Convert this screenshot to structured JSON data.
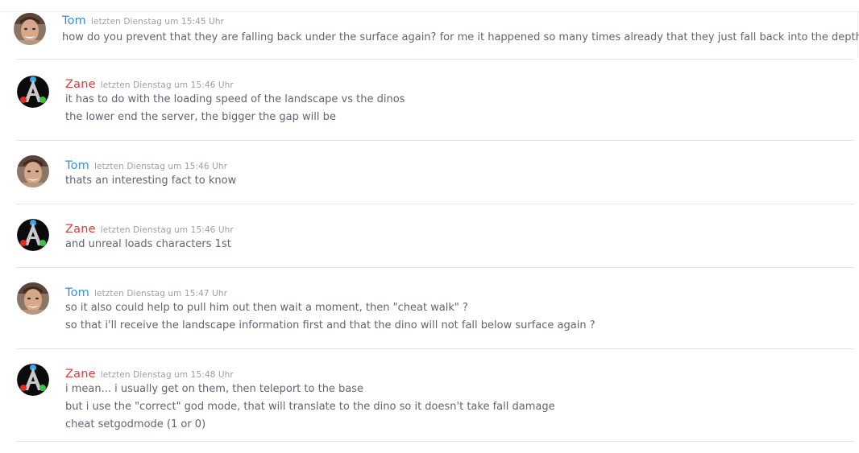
{
  "messages": [
    {
      "author": "Tom",
      "timestamp": "letzten Dienstag um 15:45 Uhr",
      "avatar": "tom-avatar",
      "lines": [
        "how do you prevent that they are falling back under the surface again? for me it happened so many times already that they just fall back into the depth"
      ]
    },
    {
      "author": "Zane",
      "timestamp": "letzten Dienstag um 15:46 Uhr",
      "avatar": "ark-logo-avatar",
      "lines": [
        "it has to do with the loading speed of the landscape vs the dinos",
        "the lower end the server, the bigger the gap will be"
      ]
    },
    {
      "author": "Tom",
      "timestamp": "letzten Dienstag um 15:46 Uhr",
      "avatar": "tom-avatar",
      "lines": [
        "thats an interesting fact to know"
      ]
    },
    {
      "author": "Zane",
      "timestamp": "letzten Dienstag um 15:46 Uhr",
      "avatar": "ark-logo-avatar",
      "lines": [
        "and unreal loads characters 1st"
      ]
    },
    {
      "author": "Tom",
      "timestamp": "letzten Dienstag um 15:47 Uhr",
      "avatar": "tom-avatar",
      "lines": [
        "so it also could help to pull him out then wait a moment, then \"cheat walk\" ?",
        "so that i'll receive the landscape information first and that the dino will not fall below surface again ?"
      ]
    },
    {
      "author": "Zane",
      "timestamp": "letzten Dienstag um 15:48 Uhr",
      "avatar": "ark-logo-avatar",
      "lines": [
        "i mean... i usually get on them, then teleport to the base",
        "but i use the \"correct\" god mode, that will translate to the dino so it doesn't take fall damage",
        "cheat setgodmode (1 or 0)"
      ]
    }
  ],
  "colors": {
    "tom_name": "#3b8ed6",
    "zane_name": "#e23b3b",
    "text": "#5f6570",
    "timestamp": "#9a9fa6",
    "divider": "#e3e5e8"
  }
}
